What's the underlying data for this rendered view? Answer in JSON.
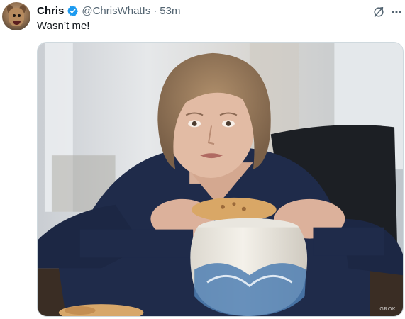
{
  "tweet": {
    "author_name": "Chris",
    "handle": "@ChrisWhatIs",
    "separator": "·",
    "time": "53m",
    "text": "Wasn’t me!",
    "avatar_icon": "dog-avatar",
    "verified_icon": "verified-badge-icon",
    "verified_color": "#1d9bf0",
    "action_icons": [
      "grok-icon",
      "more-icon"
    ]
  },
  "media": {
    "watermark": "GROK"
  },
  "colors": {
    "text_primary": "#0f1419",
    "text_secondary": "#536471",
    "border": "#cfd9de"
  }
}
